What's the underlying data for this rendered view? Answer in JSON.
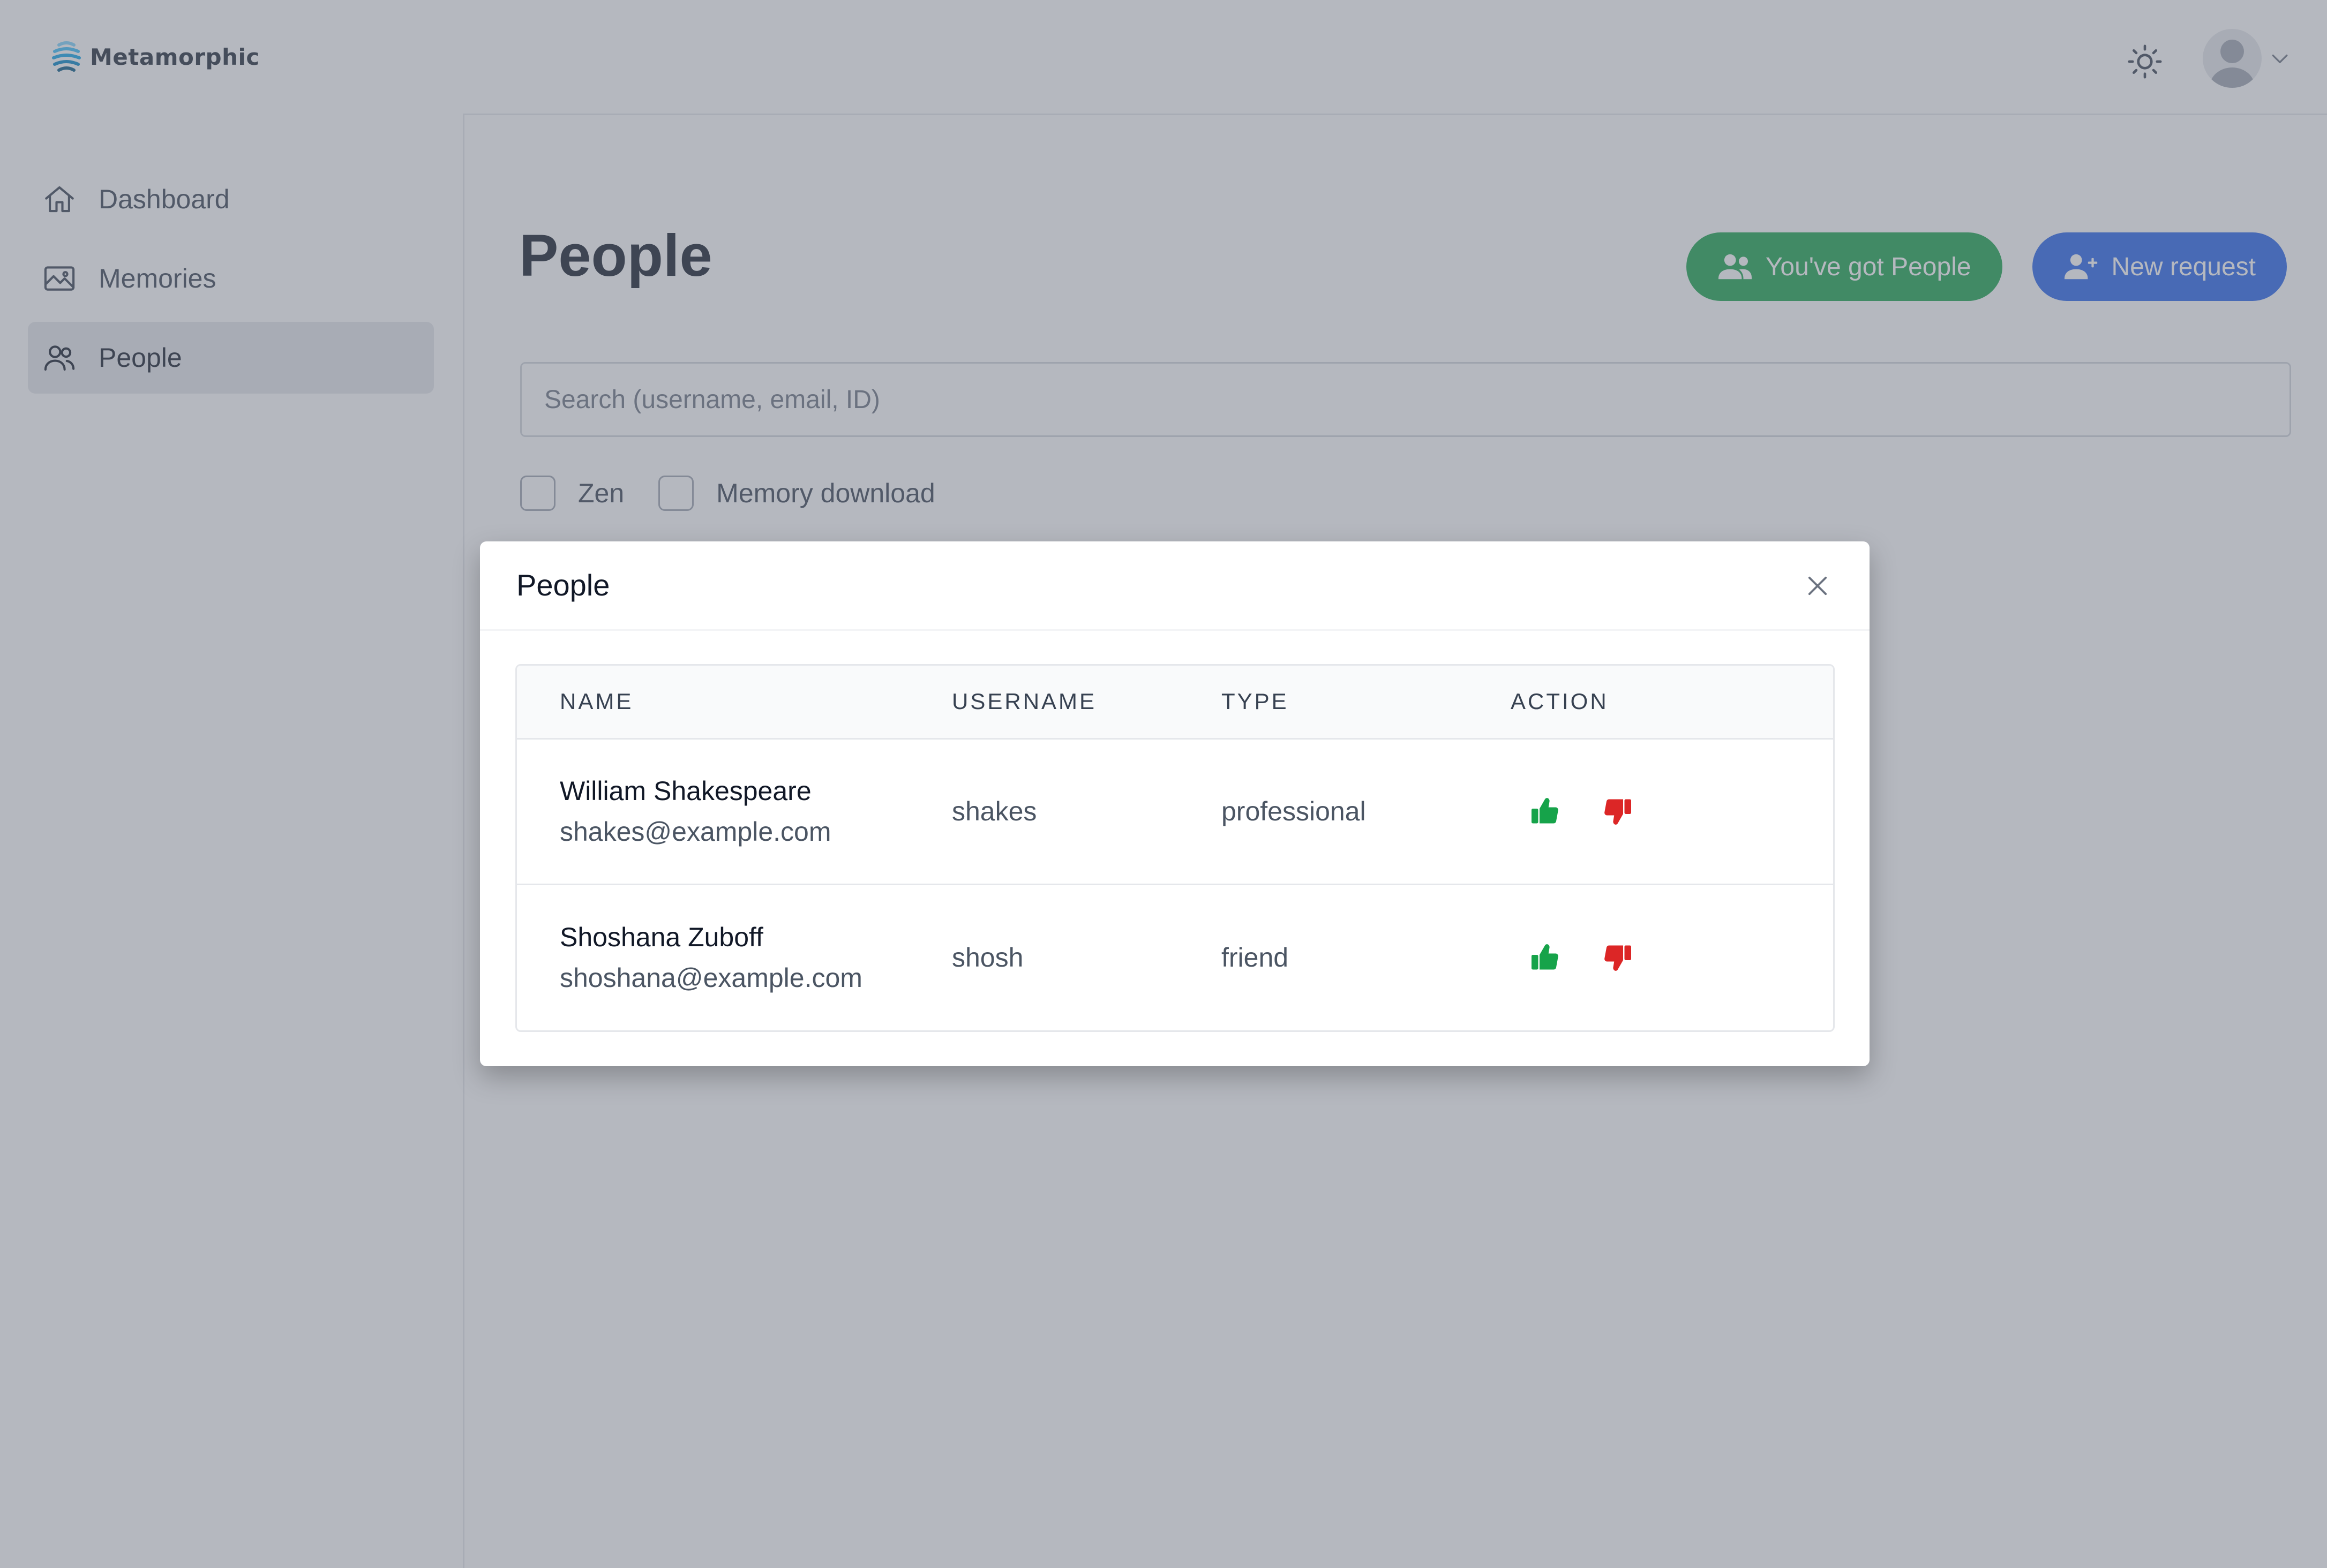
{
  "brand": {
    "name": "Metamorphic",
    "logo_icon": "wave-globe-icon"
  },
  "header": {
    "theme_icon": "sun-icon",
    "avatar_icon": "user-avatar-icon",
    "menu_icon": "chevron-down-icon"
  },
  "sidebar": {
    "items": [
      {
        "label": "Dashboard",
        "icon": "home-icon",
        "active": false
      },
      {
        "label": "Memories",
        "icon": "image-icon",
        "active": false
      },
      {
        "label": "People",
        "icon": "users-icon",
        "active": true
      }
    ]
  },
  "main": {
    "title": "People",
    "actions": {
      "got_people": {
        "label": "You've got People",
        "icon": "users-icon",
        "color": "#16a34a"
      },
      "new_request": {
        "label": "New request",
        "icon": "user-plus-icon",
        "color": "#2563eb"
      }
    },
    "search": {
      "placeholder": "Search (username, email, ID)",
      "value": ""
    },
    "filters": [
      {
        "label": "Zen",
        "checked": false
      },
      {
        "label": "Memory download",
        "checked": false
      }
    ]
  },
  "modal": {
    "title": "People",
    "close_icon": "close-icon",
    "columns": [
      "NAME",
      "USERNAME",
      "TYPE",
      "ACTION"
    ],
    "rows": [
      {
        "name": "William Shakespeare",
        "email": "shakes@example.com",
        "username": "shakes",
        "type": "professional"
      },
      {
        "name": "Shoshana Zuboff",
        "email": "shoshana@example.com",
        "username": "shosh",
        "type": "friend"
      }
    ],
    "action_icons": {
      "accept": "thumbs-up-icon",
      "reject": "thumbs-down-icon"
    },
    "action_colors": {
      "accept": "#16a34a",
      "reject": "#dc2626"
    }
  }
}
